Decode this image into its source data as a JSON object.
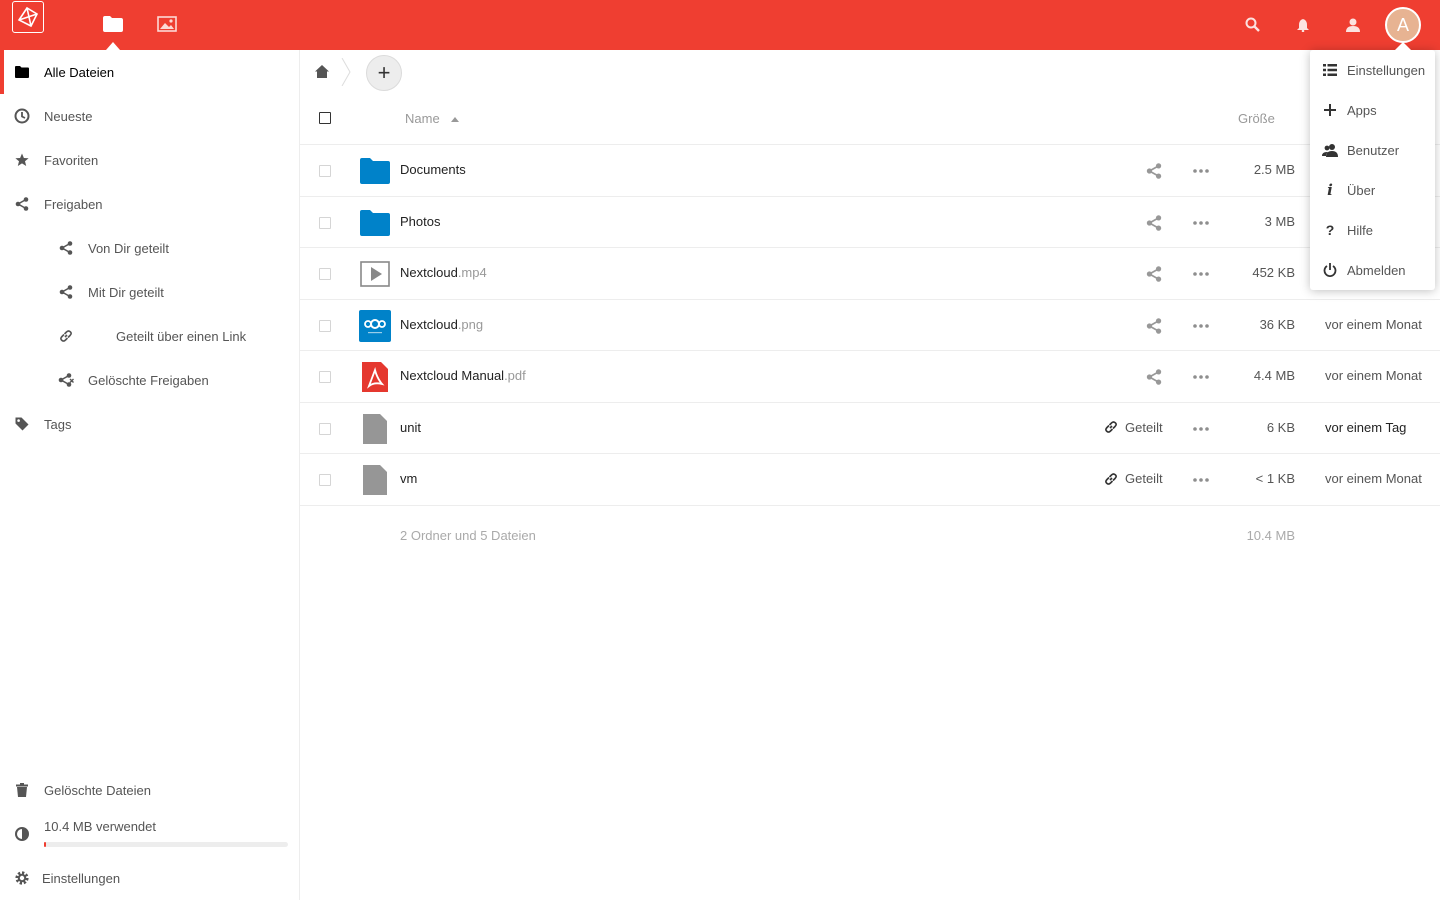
{
  "header": {
    "logo_icon": "nextcloud-logo-icon",
    "apps": [
      {
        "name": "files-app-icon"
      },
      {
        "name": "gallery-app-icon"
      }
    ],
    "search_icon": "search-icon",
    "notifications_icon": "bell-icon",
    "contacts_icon": "contacts-icon",
    "avatar_letter": "A",
    "colors": {
      "primary": "#ef3e31",
      "avatar": "#e7b392"
    }
  },
  "sidebar": {
    "items": [
      {
        "label": "Alle Dateien",
        "icon": "folder-icon",
        "active": true
      },
      {
        "label": "Neueste",
        "icon": "clock-icon"
      },
      {
        "label": "Favoriten",
        "icon": "star-icon"
      },
      {
        "label": "Freigaben",
        "icon": "share-icon"
      },
      {
        "label": "Von Dir geteilt",
        "icon": "share-icon"
      },
      {
        "label": "Mit Dir geteilt",
        "icon": "share-icon"
      },
      {
        "label": "Geteilt über einen Link",
        "icon": "link-icon"
      },
      {
        "label": "Gelöschte Freigaben",
        "icon": "share-deleted-icon"
      },
      {
        "label": "Tags",
        "icon": "tag-icon"
      }
    ],
    "deleted_files": "Gelöschte Dateien",
    "quota_text": "10.4 MB verwendet",
    "quota_fraction": 0.01,
    "settings": "Einstellungen"
  },
  "main": {
    "new_button": "+",
    "columns": {
      "name": "Name",
      "size": "Größe"
    },
    "files": [
      {
        "base": "Documents",
        "ext": "",
        "type": "folder",
        "size": "2.5 MB",
        "date": ""
      },
      {
        "base": "Photos",
        "ext": "",
        "type": "folder",
        "size": "3 MB",
        "date": ""
      },
      {
        "base": "Nextcloud",
        "ext": ".mp4",
        "type": "video",
        "size": "452 KB",
        "date": ""
      },
      {
        "base": "Nextcloud",
        "ext": ".png",
        "type": "image",
        "size": "36 KB",
        "date": "vor einem Monat"
      },
      {
        "base": "Nextcloud Manual",
        "ext": ".pdf",
        "type": "pdf",
        "size": "4.4 MB",
        "date": "vor einem Monat"
      },
      {
        "base": "unit",
        "ext": "",
        "type": "file",
        "size": "6 KB",
        "date": "vor einem Tag",
        "shared": "Geteilt"
      },
      {
        "base": "vm",
        "ext": "",
        "type": "file",
        "size": "< 1 KB",
        "date": "vor einem Monat",
        "shared": "Geteilt"
      }
    ],
    "summary": {
      "text": "2 Ordner und 5 Dateien",
      "size": "10.4 MB"
    }
  },
  "menu": {
    "items": [
      {
        "label": "Einstellungen",
        "icon": "settings-list-icon"
      },
      {
        "label": "Apps",
        "icon": "plus-icon"
      },
      {
        "label": "Benutzer",
        "icon": "users-icon"
      },
      {
        "label": "Über",
        "icon": "info-icon"
      },
      {
        "label": "Hilfe",
        "icon": "help-icon"
      },
      {
        "label": "Abmelden",
        "icon": "power-icon"
      }
    ]
  }
}
